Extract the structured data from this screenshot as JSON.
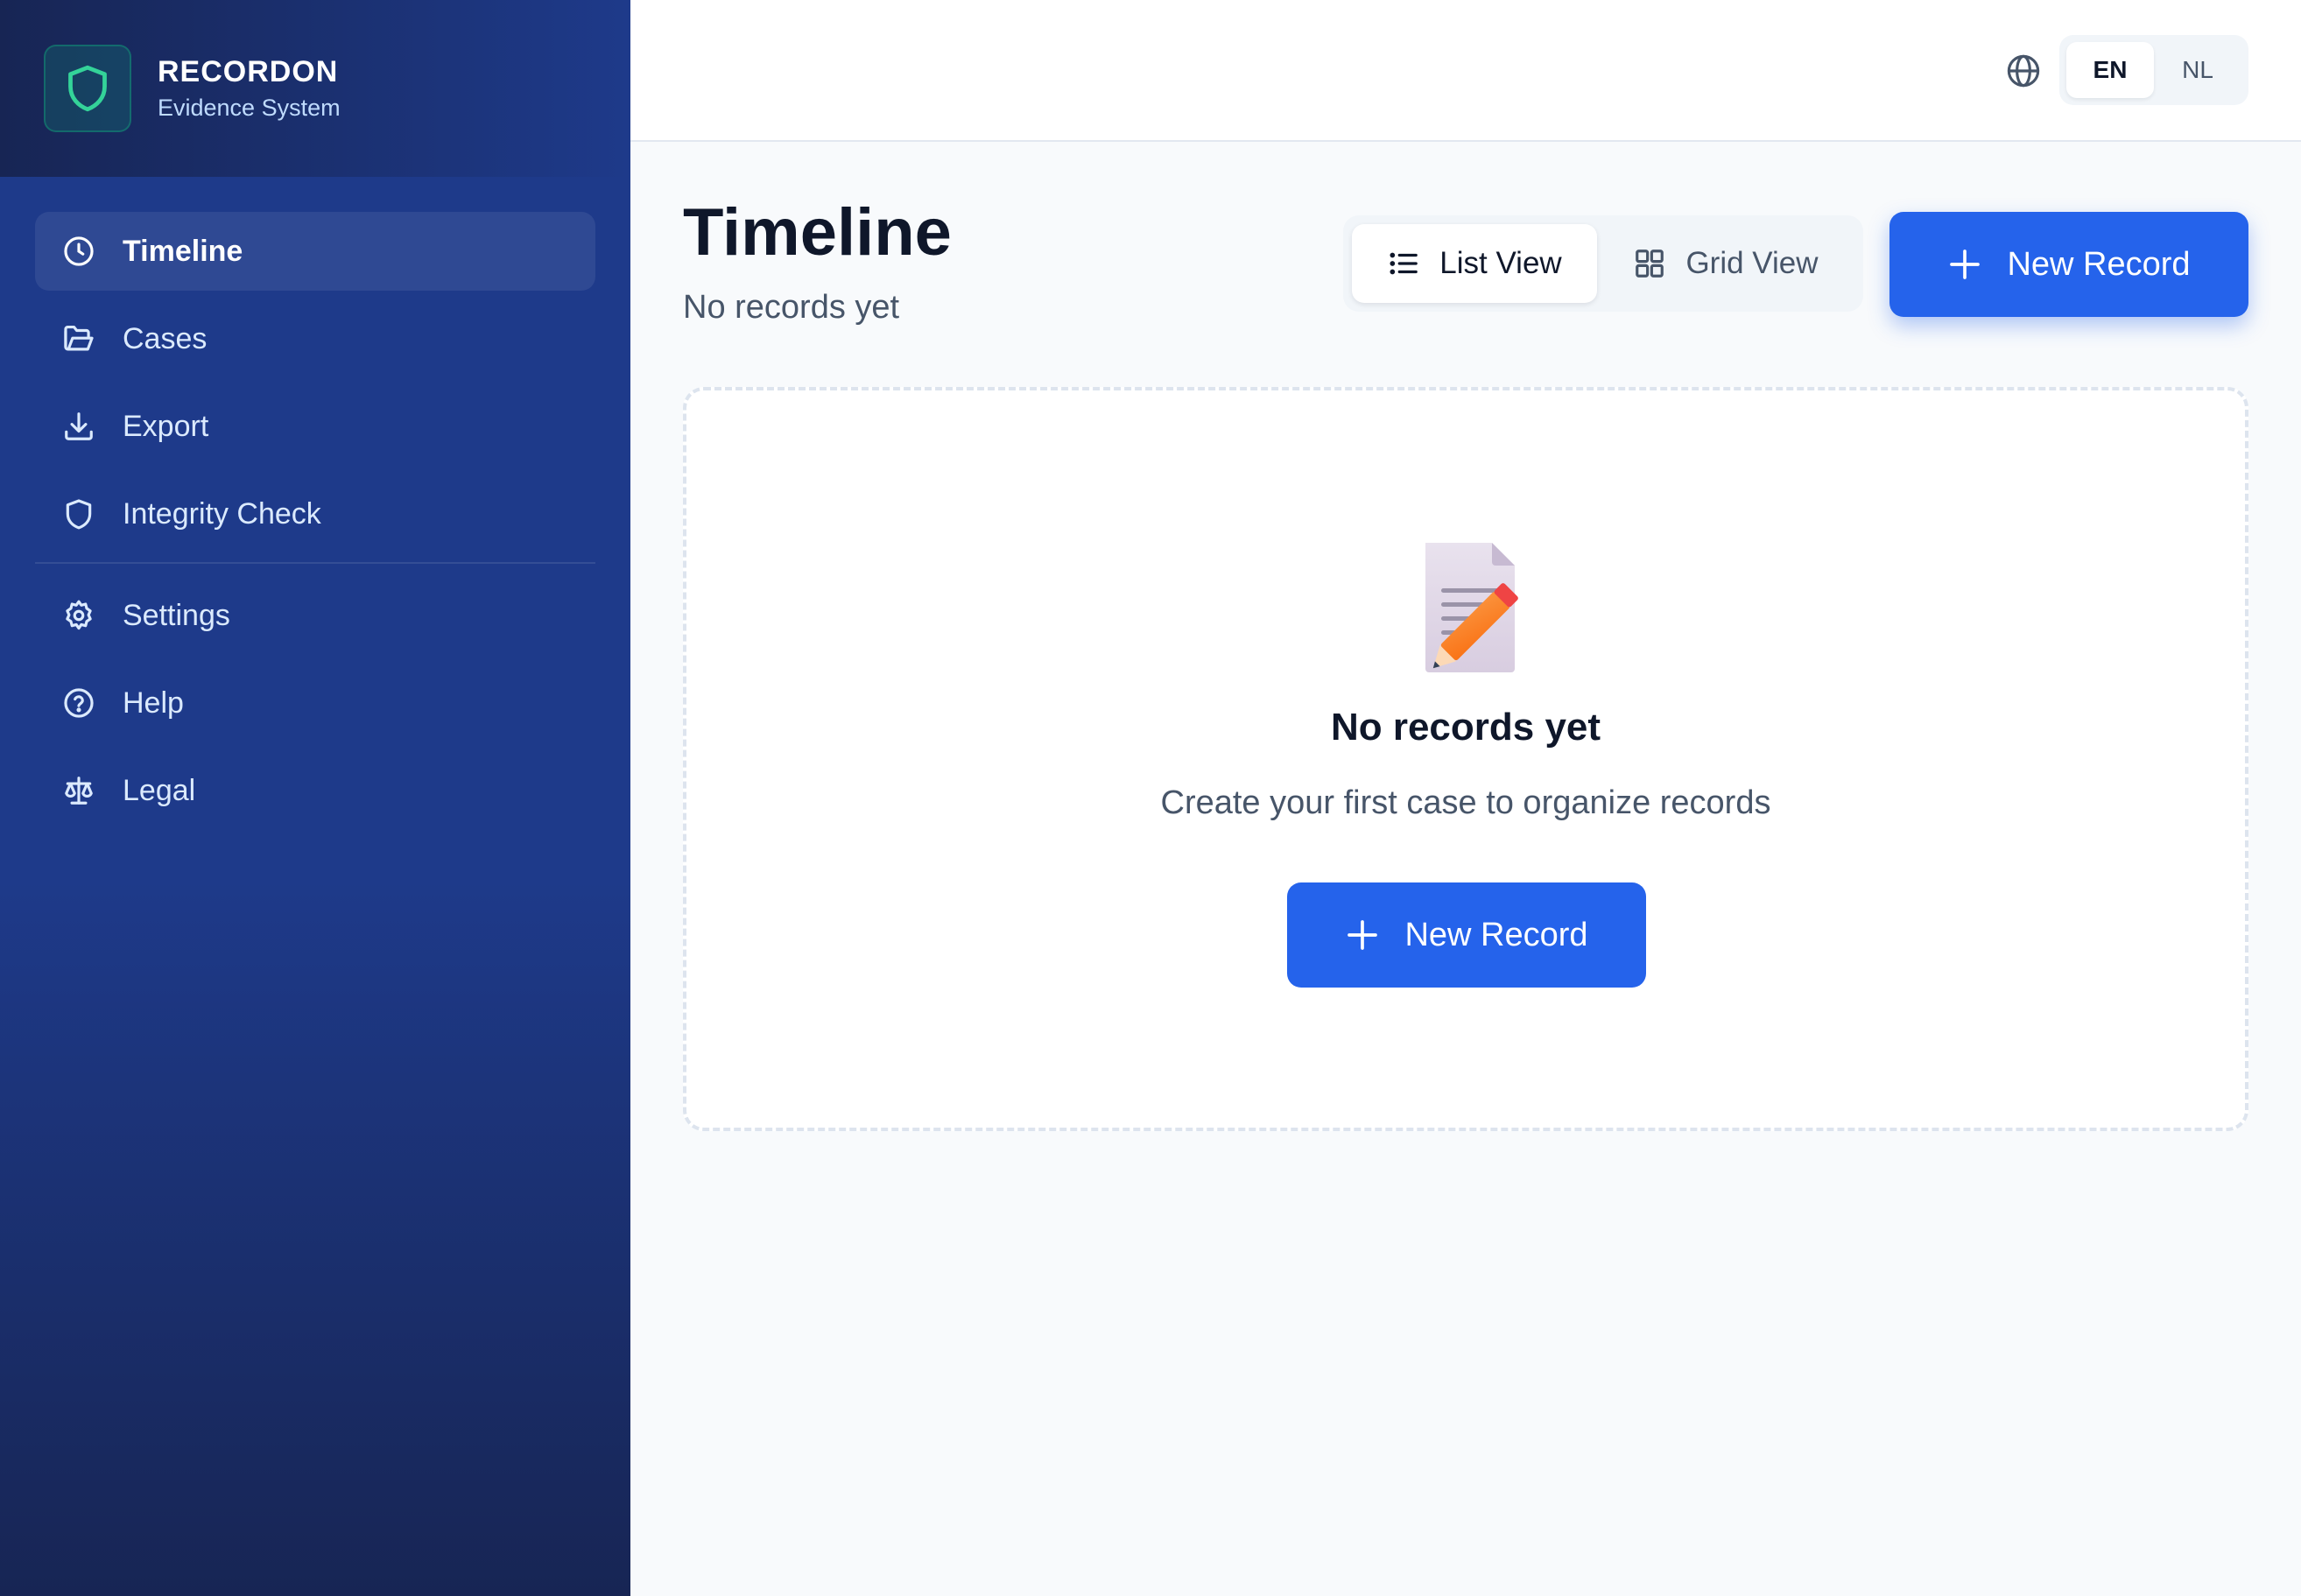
{
  "app": {
    "name": "RECORDON",
    "subtitle": "Evidence System"
  },
  "sidebar": {
    "items": [
      {
        "label": "Timeline",
        "icon": "clock-icon",
        "active": true
      },
      {
        "label": "Cases",
        "icon": "folder-icon"
      },
      {
        "label": "Export",
        "icon": "download-icon"
      },
      {
        "label": "Integrity Check",
        "icon": "shield-icon"
      },
      {
        "label": "Settings",
        "icon": "gear-icon"
      },
      {
        "label": "Help",
        "icon": "help-circle-icon"
      },
      {
        "label": "Legal",
        "icon": "scale-icon"
      }
    ]
  },
  "topbar": {
    "languages": [
      "EN",
      "NL"
    ],
    "selected_language": "EN"
  },
  "page": {
    "title": "Timeline",
    "subtitle": "No records yet",
    "view_toggle": {
      "list_label": "List View",
      "grid_label": "Grid View",
      "selected": "List View"
    },
    "new_record_label": "New Record"
  },
  "empty_state": {
    "icon": "memo-icon",
    "title": "No records yet",
    "message": "Create your first case to organize records",
    "button_label": "New Record"
  },
  "colors": {
    "sidebar": "#1e3a8a",
    "accent": "#2563eb",
    "brand_shield": "#34d399",
    "background": "#f8fafc"
  }
}
